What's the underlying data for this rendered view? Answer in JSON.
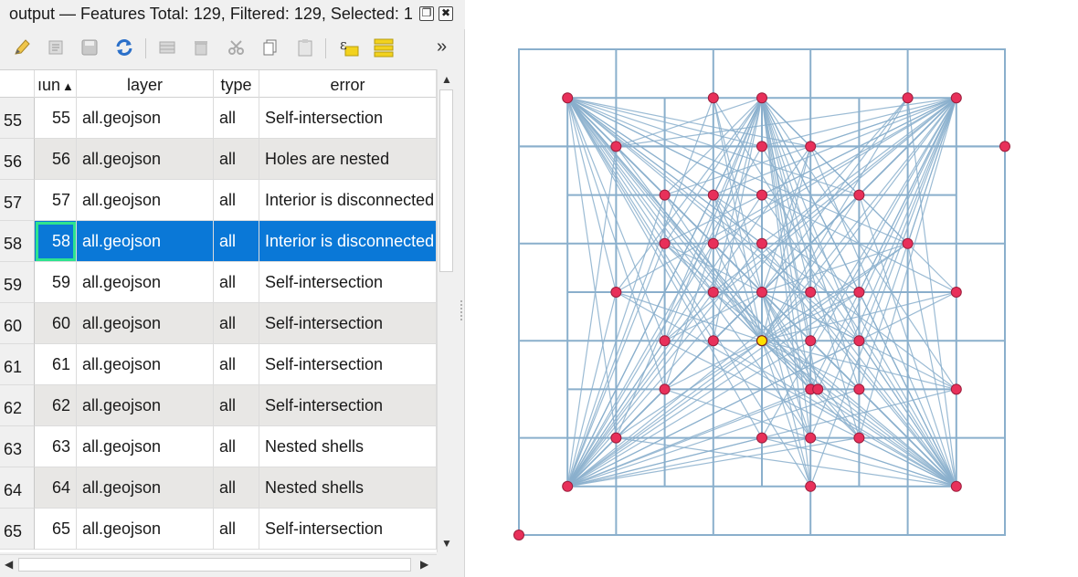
{
  "window": {
    "title": "output — Features Total: 129, Filtered: 129, Selected: 1",
    "restore_icon": "restore-window-icon",
    "close_icon": "close-window-icon"
  },
  "toolbar": {
    "icons": [
      "pencil-edit-icon",
      "multi-edit-icon",
      "save-edits-icon",
      "reload-icon",
      "add-feature-icon",
      "delete-feature-icon",
      "cut-icon",
      "copy-icon",
      "paste-icon",
      "expression-select-icon",
      "select-all-icon"
    ],
    "overflow_label": "»"
  },
  "table": {
    "columns": [
      "ıun",
      "layer",
      "type",
      "error"
    ],
    "sort_indicator": "▲",
    "rows": [
      {
        "header": "55",
        "num": "55",
        "layer": "all.geojson",
        "type": "all",
        "error": "Self-intersection"
      },
      {
        "header": "56",
        "num": "56",
        "layer": "all.geojson",
        "type": "all",
        "error": "Holes are nested"
      },
      {
        "header": "57",
        "num": "57",
        "layer": "all.geojson",
        "type": "all",
        "error": "Interior is disconnected"
      },
      {
        "header": "58",
        "num": "58",
        "layer": "all.geojson",
        "type": "all",
        "error": "Interior is disconnected"
      },
      {
        "header": "59",
        "num": "59",
        "layer": "all.geojson",
        "type": "all",
        "error": "Self-intersection"
      },
      {
        "header": "60",
        "num": "60",
        "layer": "all.geojson",
        "type": "all",
        "error": "Self-intersection"
      },
      {
        "header": "61",
        "num": "61",
        "layer": "all.geojson",
        "type": "all",
        "error": "Self-intersection"
      },
      {
        "header": "62",
        "num": "62",
        "layer": "all.geojson",
        "type": "all",
        "error": "Self-intersection"
      },
      {
        "header": "63",
        "num": "63",
        "layer": "all.geojson",
        "type": "all",
        "error": "Nested shells"
      },
      {
        "header": "64",
        "num": "64",
        "layer": "all.geojson",
        "type": "all",
        "error": "Nested shells"
      },
      {
        "header": "65",
        "num": "65",
        "layer": "all.geojson",
        "type": "all",
        "error": "Self-intersection"
      }
    ],
    "selected_row": "58"
  },
  "map": {
    "line_color": "#8aafcc",
    "point_color": "#e8305a",
    "selected_point_color": "#ffe000"
  }
}
